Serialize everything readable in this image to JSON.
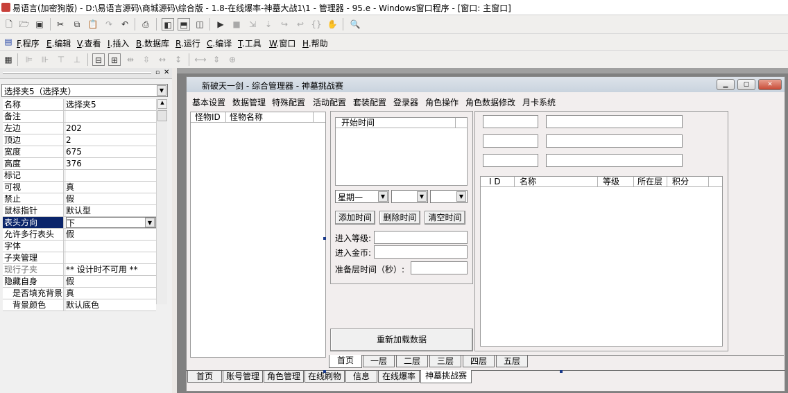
{
  "window": {
    "title": "易语言(加密狗版) - D:\\易语言源码\\商城源码\\综合版 - 1.8-在线爆率-神墓大战1\\1 - 管理器 - 95.e - Windows窗口程序 - [窗口: 主窗口]"
  },
  "menu": [
    {
      "key": "F",
      "label": ".程序"
    },
    {
      "key": "E",
      "label": ".编辑"
    },
    {
      "key": "V",
      "label": ".查看"
    },
    {
      "key": "I",
      "label": ".插入"
    },
    {
      "key": "B",
      "label": ".数据库"
    },
    {
      "key": "R",
      "label": ".运行"
    },
    {
      "key": "C",
      "label": ".编译"
    },
    {
      "key": "T",
      "label": ".工具"
    },
    {
      "key": "W",
      "label": ".窗口"
    },
    {
      "key": "H",
      "label": ".帮助"
    }
  ],
  "properties": {
    "selected_object": "选择夹5（选择夹）",
    "rows": [
      {
        "key": "名称",
        "value": "选择夹5"
      },
      {
        "key": "备注",
        "value": ""
      },
      {
        "key": "左边",
        "value": "202"
      },
      {
        "key": "顶边",
        "value": "2"
      },
      {
        "key": "宽度",
        "value": "675"
      },
      {
        "key": "高度",
        "value": "376"
      },
      {
        "key": "标记",
        "value": ""
      },
      {
        "key": "可视",
        "value": "真"
      },
      {
        "key": "禁止",
        "value": "假"
      },
      {
        "key": "鼠标指针",
        "value": "默认型"
      },
      {
        "key": "表头方向",
        "value": "下"
      },
      {
        "key": "允许多行表头",
        "value": "假"
      },
      {
        "key": "字体",
        "value": ""
      },
      {
        "key": "子夹管理",
        "value": ""
      },
      {
        "key": "现行子夹",
        "value": "** 设计时不可用 **"
      },
      {
        "key": "隐藏自身",
        "value": "假"
      },
      {
        "key": "是否填充背景",
        "value": "真"
      },
      {
        "key": "背景颜色",
        "value": "默认底色"
      }
    ]
  },
  "form": {
    "title": "新破天一剑 - 综合管理器 - 神墓挑战赛",
    "menu": [
      "基本设置",
      "数据管理",
      "特殊配置",
      "活动配置",
      "套装配置",
      "登录器",
      "角色操作",
      "角色数据修改",
      "月卡系统"
    ],
    "monster_list": {
      "columns": [
        "怪物ID",
        "怪物名称"
      ]
    },
    "time_list": {
      "columns": [
        "开始时间"
      ]
    },
    "weekday_value": "星期一",
    "buttons": {
      "add_time": "添加时间",
      "delete_time": "删除时间",
      "clear_time": "清空时间",
      "reload": "重新加载数据"
    },
    "labels": {
      "enter_level": "进入等级:",
      "enter_gold": "进入金币:",
      "prep_time": "准备层时间（秒）:"
    },
    "rank_table": {
      "columns": [
        "I D",
        "名称",
        "等级",
        "所在层",
        "积分"
      ]
    },
    "floor_tabs": [
      "首页",
      "一层",
      "二层",
      "三层",
      "四层",
      "五层"
    ],
    "bottom_tabs": [
      "首页",
      "账号管理",
      "角色管理",
      "在线刷物",
      "信息",
      "在线爆率",
      "神墓挑战赛"
    ]
  },
  "colors": {
    "selected_row": "#0a246a",
    "workspace": "#808080"
  }
}
